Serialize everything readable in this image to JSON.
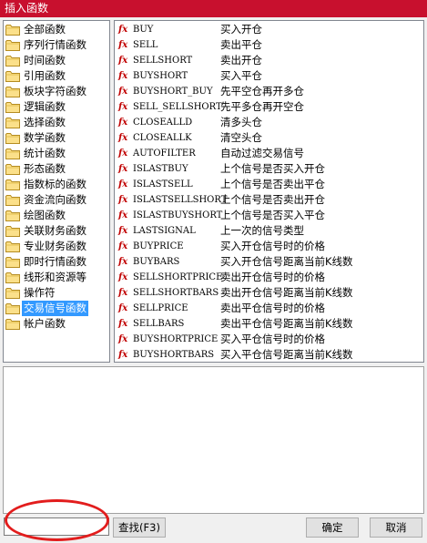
{
  "window": {
    "title": "插入函数"
  },
  "categories": [
    {
      "label": "全部函数"
    },
    {
      "label": "序列行情函数"
    },
    {
      "label": "时间函数"
    },
    {
      "label": "引用函数"
    },
    {
      "label": "板块字符函数"
    },
    {
      "label": "逻辑函数"
    },
    {
      "label": "选择函数"
    },
    {
      "label": "数学函数"
    },
    {
      "label": "统计函数"
    },
    {
      "label": "形态函数"
    },
    {
      "label": "指数标的函数"
    },
    {
      "label": "资金流向函数"
    },
    {
      "label": "绘图函数"
    },
    {
      "label": "关联财务函数"
    },
    {
      "label": "专业财务函数"
    },
    {
      "label": "即时行情函数"
    },
    {
      "label": "线形和资源等"
    },
    {
      "label": "操作符"
    },
    {
      "label": "交易信号函数",
      "selected": true
    },
    {
      "label": "帐户函数"
    }
  ],
  "functions": [
    {
      "icon": "fx",
      "name": "BUY",
      "desc": "买入开仓"
    },
    {
      "icon": "fx",
      "name": "SELL",
      "desc": "卖出平仓"
    },
    {
      "icon": "fx",
      "name": "SELLSHORT",
      "desc": "卖出开仓"
    },
    {
      "icon": "fx",
      "name": "BUYSHORT",
      "desc": "买入平仓"
    },
    {
      "icon": "fx",
      "name": "BUYSHORT_BUY",
      "desc": "先平空仓再开多仓"
    },
    {
      "icon": "fx",
      "name": "SELL_SELLSHORT",
      "desc": "先平多仓再开空仓"
    },
    {
      "icon": "fx",
      "name": "CLOSEALLD",
      "desc": "清多头仓"
    },
    {
      "icon": "fx",
      "name": "CLOSEALLK",
      "desc": "清空头仓"
    },
    {
      "icon": "fx",
      "name": "AUTOFILTER",
      "desc": "自动过滤交易信号"
    },
    {
      "icon": "fx",
      "name": "ISLASTBUY",
      "desc": "上个信号是否买入开仓"
    },
    {
      "icon": "fx",
      "name": "ISLASTSELL",
      "desc": "上个信号是否卖出平仓"
    },
    {
      "icon": "fx",
      "name": "ISLASTSELLSHORT",
      "desc": "上个信号是否卖出开仓"
    },
    {
      "icon": "fx",
      "name": "ISLASTBUYSHORT",
      "desc": "上个信号是否买入平仓"
    },
    {
      "icon": "fx",
      "name": "LASTSIGNAL",
      "desc": "上一次的信号类型"
    },
    {
      "icon": "fx",
      "name": "BUYPRICE",
      "desc": "买入开仓信号时的价格"
    },
    {
      "icon": "fx",
      "name": "BUYBARS",
      "desc": "买入开仓信号距离当前K线数"
    },
    {
      "icon": "fx",
      "name": "SELLSHORTPRICE",
      "desc": "卖出开仓信号时的价格"
    },
    {
      "icon": "fx",
      "name": "SELLSHORTBARS",
      "desc": "卖出开仓信号距离当前K线数"
    },
    {
      "icon": "fx",
      "name": "SELLPRICE",
      "desc": "卖出平仓信号时的价格"
    },
    {
      "icon": "fx",
      "name": "SELLBARS",
      "desc": "卖出平仓信号距离当前K线数"
    },
    {
      "icon": "fx",
      "name": "BUYSHORTPRICE",
      "desc": "买入平仓信号时的价格"
    },
    {
      "icon": "fx",
      "name": "BUYSHORTBARS",
      "desc": "买入平仓信号距离当前K线数"
    }
  ],
  "search": {
    "value": "",
    "find_label": "查找(F3)"
  },
  "buttons": {
    "ok": "确定",
    "cancel": "取消"
  },
  "colors": {
    "titlebar": "#c8102e",
    "selection": "#3399ff",
    "fx_icon": "#c00000",
    "annotation": "#e21d1d"
  }
}
